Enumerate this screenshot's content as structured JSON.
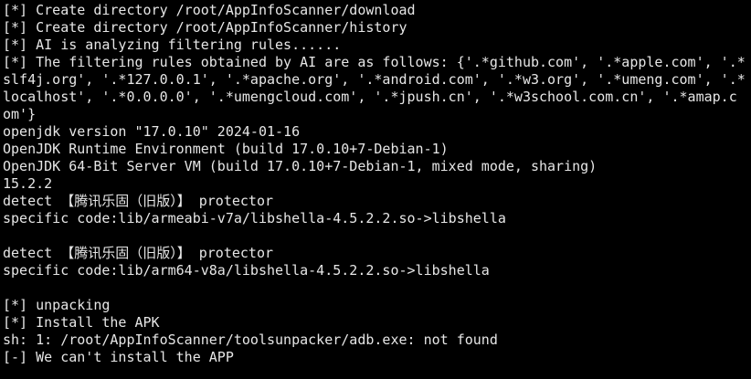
{
  "terminal": {
    "lines": [
      "[*] Create directory /root/AppInfoScanner/download",
      "[*] Create directory /root/AppInfoScanner/history",
      "[*] AI is analyzing filtering rules......",
      "[*] The filtering rules obtained by AI are as follows: {'.*github.com', '.*apple.com', '.*",
      "slf4j.org', '.*127.0.0.1', '.*apache.org', '.*android.com', '.*w3.org', '.*umeng.com', '.*",
      "localhost', '.*0.0.0.0', '.*umengcloud.com', '.*jpush.cn', '.*w3school.com.cn', '.*amap.c",
      "om'}",
      "openjdk version \"17.0.10\" 2024-01-16",
      "OpenJDK Runtime Environment (build 17.0.10+7-Debian-1)",
      "OpenJDK 64-Bit Server VM (build 17.0.10+7-Debian-1, mixed mode, sharing)",
      "15.2.2",
      "detect 【腾讯乐固（旧版）】 protector",
      "specific code:lib/armeabi-v7a/libshella-4.5.2.2.so->libshella",
      "",
      "detect 【腾讯乐固（旧版）】 protector",
      "specific code:lib/arm64-v8a/libshella-4.5.2.2.so->libshella",
      "",
      "[*] unpacking",
      "[*] Install the APK",
      "sh: 1: /root/AppInfoScanner/toolsunpacker/adb.exe: not found",
      "[-] We can't install the APP"
    ]
  }
}
